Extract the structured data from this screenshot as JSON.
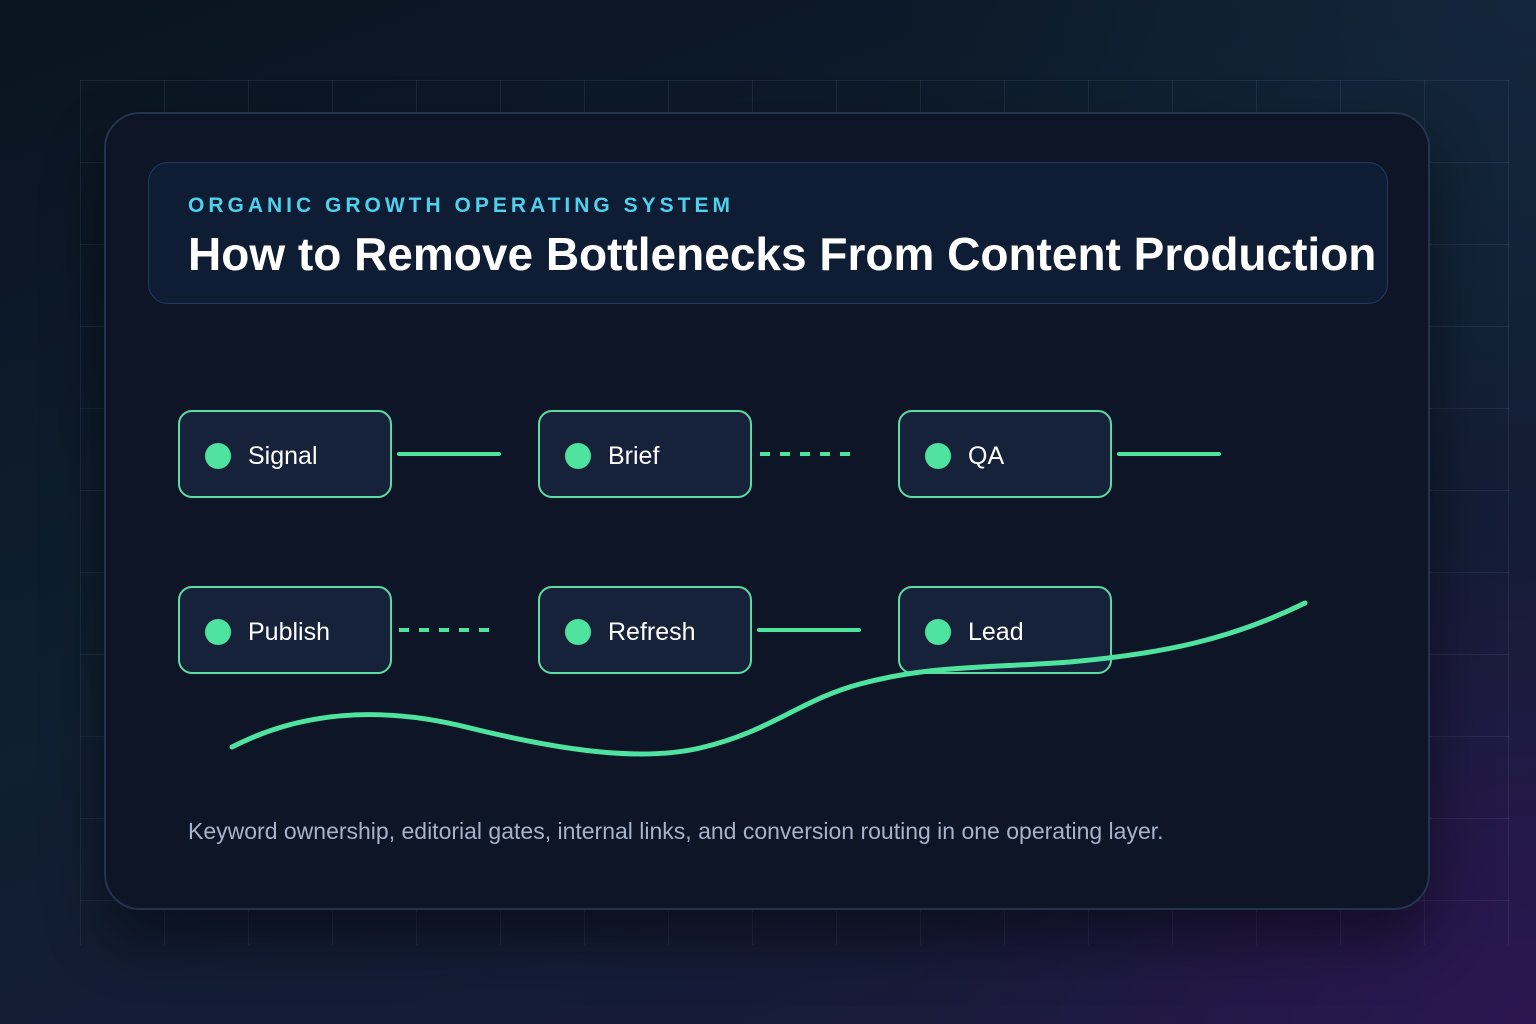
{
  "header": {
    "eyebrow": "ORGANIC GROWTH OPERATING SYSTEM",
    "title": "How to Remove Bottlenecks From Content Production"
  },
  "nodes": [
    {
      "label": "Signal"
    },
    {
      "label": "Brief"
    },
    {
      "label": "QA"
    },
    {
      "label": "Publish"
    },
    {
      "label": "Refresh"
    },
    {
      "label": "Lead"
    }
  ],
  "connectors": [
    {
      "style": "solid"
    },
    {
      "style": "dashed"
    },
    {
      "style": "solid"
    },
    {
      "style": "dashed"
    },
    {
      "style": "solid"
    }
  ],
  "caption": "Keyword ownership, editorial gates, internal links, and conversion routing in one operating layer.",
  "colors": {
    "accent_green": "#4ee39f",
    "accent_cyan": "#4fd0ec",
    "card_background": "#0d1526",
    "node_background": "#16213a"
  }
}
